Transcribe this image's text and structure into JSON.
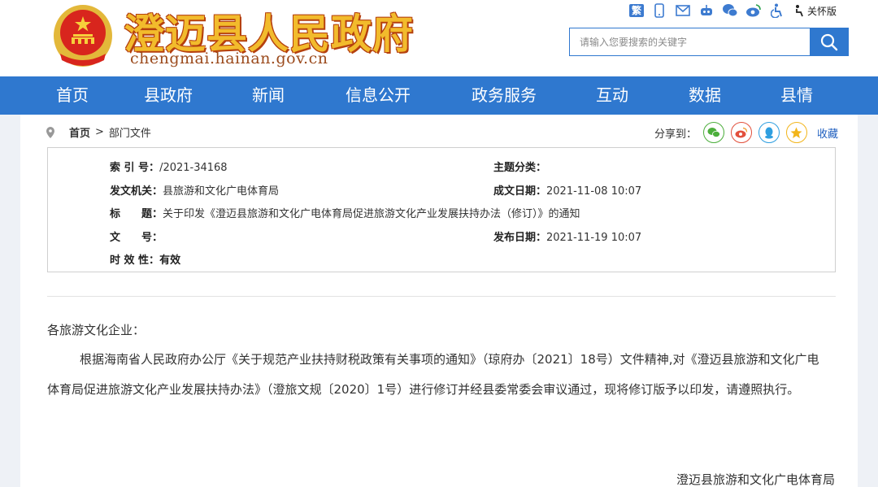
{
  "header": {
    "site_title": "澄迈县人民政府",
    "site_domain": "chengmai.hainan.gov.cn",
    "tools": {
      "traditional_label": "繁",
      "care_label": "关怀版"
    },
    "search": {
      "placeholder": "请输入您要搜索的关键字"
    }
  },
  "nav": {
    "items": [
      {
        "label": "首页"
      },
      {
        "label": "县政府"
      },
      {
        "label": "新闻"
      },
      {
        "label": "信息公开"
      },
      {
        "label": "政务服务"
      },
      {
        "label": "互动"
      },
      {
        "label": "数据"
      },
      {
        "label": "县情"
      }
    ]
  },
  "breadcrumb": {
    "home": "首页",
    "separator": ">",
    "current": "部门文件"
  },
  "share": {
    "label": "分享到：",
    "favorite": "收藏"
  },
  "info": {
    "index_label": "索 引 号：",
    "index_value": "/2021-34168",
    "topic_label": "主题分类：",
    "topic_value": "",
    "issuer_label": "发文机关：",
    "issuer_value": "县旅游和文化广电体育局",
    "written_label": "成文日期：",
    "written_value": "2021-11-08 10:07",
    "title_label": "标　　题：",
    "title_value": "关于印发《澄迈县旅游和文化广电体育局促进旅游文化产业发展扶持办法（修订）》的通知",
    "docno_label": "文　　号：",
    "docno_value": "",
    "published_label": "发布日期：",
    "published_value": "2021-11-19 10:07",
    "validity_label": "时 效 性：",
    "validity_value": "有效"
  },
  "article": {
    "salutation": "各旅游文化企业：",
    "line1": "根据海南省人民政府办公厅《关于规范产业扶持财税政策有关事项的通知》（琼府办〔2021〕18号）文件精神,对《澄迈县旅游和文化广电",
    "line2": "体育局促进旅游文化产业发展扶持办法》（澄旅文规〔2020〕1号）进行修订并经县委常委会审议通过，现将修订版予以印发，请遵照执行。",
    "signature": "澄迈县旅游和文化广电体育局"
  },
  "colors": {
    "brand_blue": "#2f78cf",
    "title_gold": "#f2bb2c",
    "emblem_red": "#d8251d"
  }
}
